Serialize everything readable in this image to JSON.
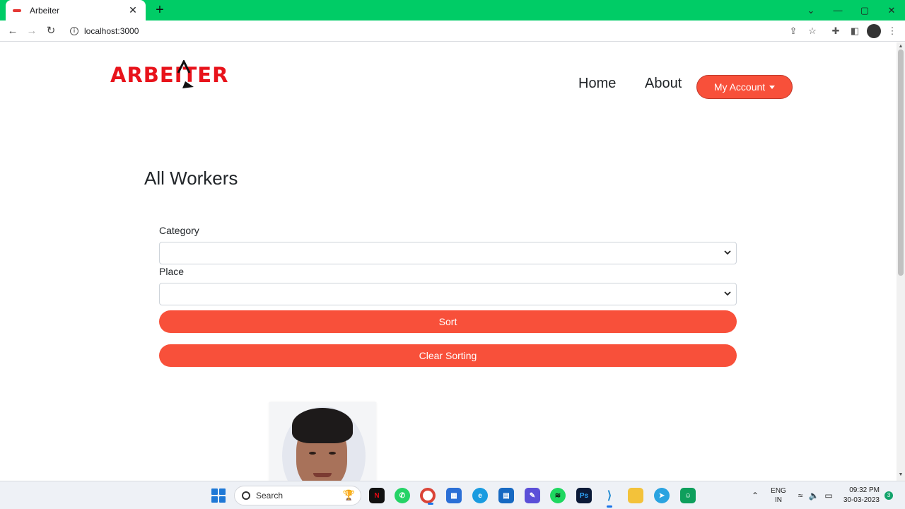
{
  "browser": {
    "tab_title": "Arbeiter",
    "tab_close": "✕",
    "new_tab": "+",
    "url": "localhost:3000",
    "window_controls": [
      "⌄",
      "—",
      "▢",
      "✕"
    ]
  },
  "header": {
    "logo_text": "ARBEITER",
    "nav": [
      "Home",
      "About"
    ],
    "account_button": "My Account"
  },
  "main": {
    "title": "All Workers",
    "category_label": "Category",
    "category_value": "",
    "place_label": "Place",
    "place_value": "",
    "sort_button": "Sort",
    "clear_button": "Clear Sorting"
  },
  "taskbar": {
    "search_label": "Search",
    "language_line1": "ENG",
    "language_line2": "IN",
    "time": "09:32 PM",
    "date": "30-03-2023",
    "notification_count": "3"
  },
  "colors": {
    "accent": "#f8503a",
    "brand": "#e8131b",
    "chrome_green": "#00cc66"
  }
}
